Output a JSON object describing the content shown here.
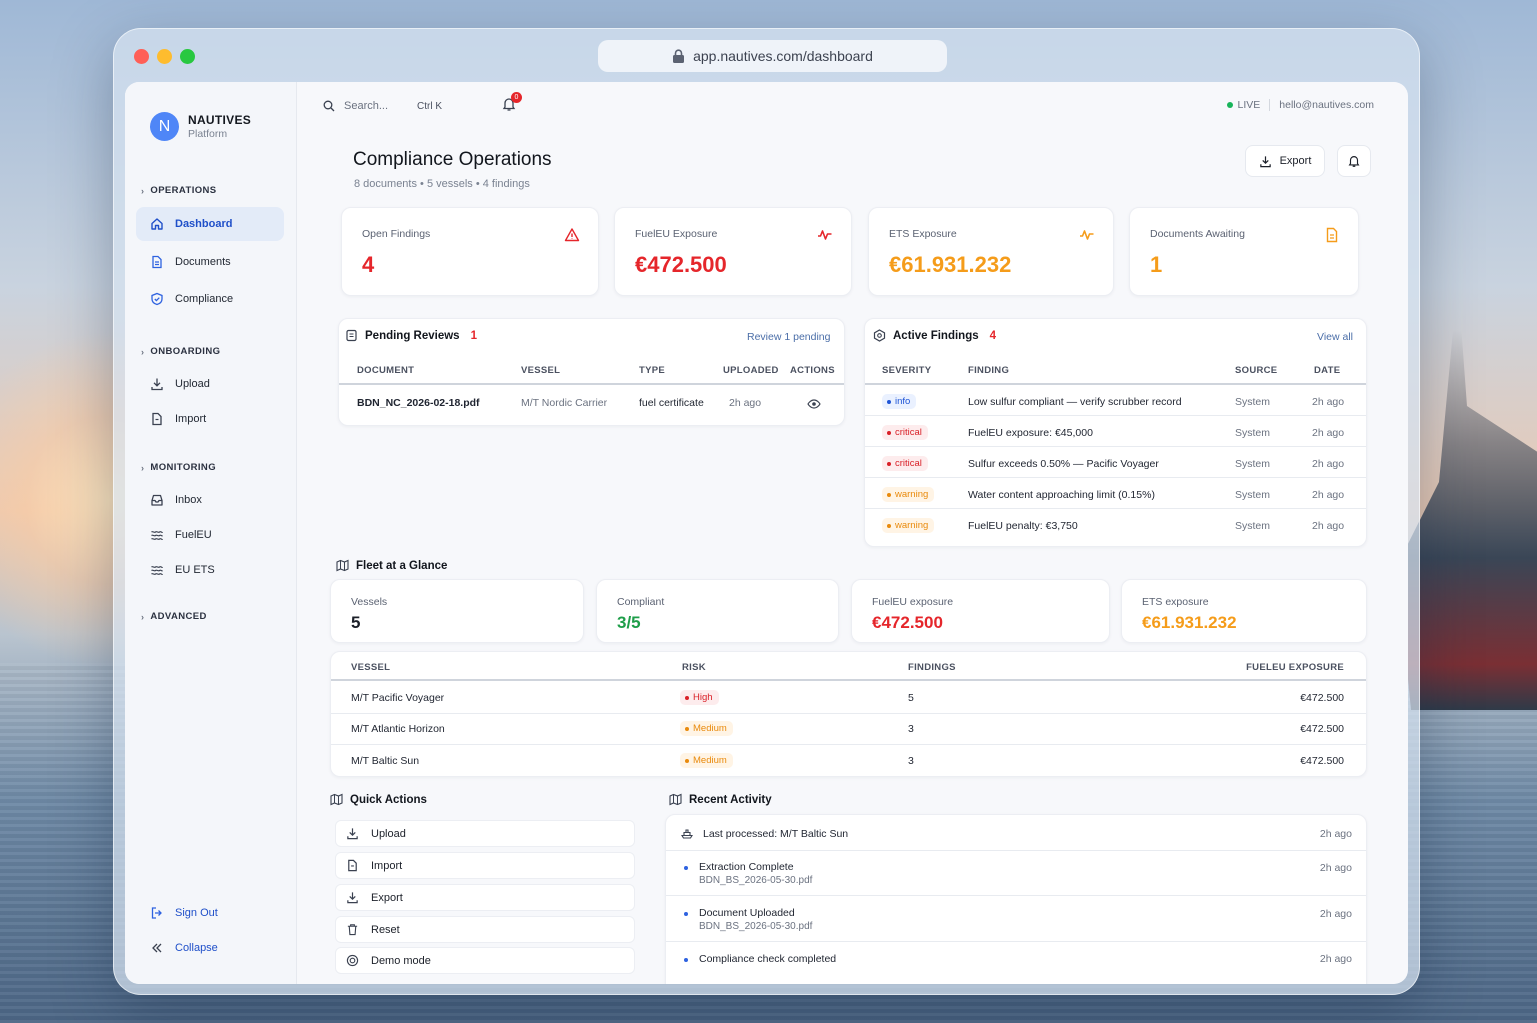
{
  "browser": {
    "url": "app.nautives.com/dashboard"
  },
  "brand": {
    "initial": "N",
    "name": "NAUTIVES",
    "subtitle": "Platform"
  },
  "sidebar": {
    "sections": [
      {
        "label": "OPERATIONS"
      },
      {
        "label": "ONBOARDING"
      },
      {
        "label": "MONITORING"
      },
      {
        "label": "ADVANCED"
      }
    ],
    "items": [
      {
        "label": "Dashboard",
        "icon": "home-icon",
        "active": true
      },
      {
        "label": "Documents",
        "icon": "document-icon"
      },
      {
        "label": "Compliance",
        "icon": "shield-icon"
      },
      {
        "label": "Upload",
        "icon": "download-icon"
      },
      {
        "label": "Import",
        "icon": "file-icon"
      },
      {
        "label": "Inbox",
        "icon": "inbox-icon"
      },
      {
        "label": "FuelEU",
        "icon": "waves-icon"
      },
      {
        "label": "EU ETS",
        "icon": "waves-icon"
      }
    ],
    "footer": {
      "sign_out": "Sign Out",
      "collapse": "Collapse"
    }
  },
  "topbar": {
    "search_placeholder": "Search...",
    "shortcut": "Ctrl K",
    "notification_count": "0",
    "status": "LIVE",
    "email": "hello@nautives.com"
  },
  "header": {
    "title": "Compliance Operations",
    "subtitle": "8 documents • 5 vessels • 4 findings",
    "export_label": "Export"
  },
  "stats": [
    {
      "label": "Open Findings",
      "value": "4",
      "color": "#e5262b",
      "icon": "alert-triangle-icon"
    },
    {
      "label": "FuelEU Exposure",
      "value": "€472.500",
      "color": "#e5262b",
      "icon": "pulse-icon"
    },
    {
      "label": "ETS Exposure",
      "value": "€61.931.232",
      "color": "#f59c1a",
      "icon": "pulse-icon"
    },
    {
      "label": "Documents Awaiting",
      "value": "1",
      "color": "#f59c1a",
      "icon": "document-icon"
    }
  ],
  "pending_reviews": {
    "title": "Pending Reviews",
    "count": "1",
    "link": "Review 1 pending",
    "columns": [
      "DOCUMENT",
      "VESSEL",
      "TYPE",
      "UPLOADED",
      "ACTIONS"
    ],
    "rows": [
      {
        "document": "BDN_NC_2026-02-18.pdf",
        "vessel": "M/T Nordic Carrier",
        "type": "fuel certificate",
        "uploaded": "2h ago"
      }
    ]
  },
  "active_findings": {
    "title": "Active Findings",
    "count": "4",
    "link": "View all",
    "columns": [
      "SEVERITY",
      "FINDING",
      "SOURCE",
      "DATE"
    ],
    "rows": [
      {
        "severity": "info",
        "finding": "Low sulfur compliant — verify scrubber record",
        "source": "System",
        "date": "2h ago"
      },
      {
        "severity": "critical",
        "finding": "FuelEU exposure: €45,000",
        "source": "System",
        "date": "2h ago"
      },
      {
        "severity": "critical",
        "finding": "Sulfur exceeds 0.50% — Pacific Voyager",
        "source": "System",
        "date": "2h ago"
      },
      {
        "severity": "warning",
        "finding": "Water content approaching limit (0.15%)",
        "source": "System",
        "date": "2h ago"
      },
      {
        "severity": "warning",
        "finding": "FuelEU penalty: €3,750",
        "source": "System",
        "date": "2h ago"
      }
    ]
  },
  "fleet": {
    "title": "Fleet at a Glance",
    "stats": [
      {
        "label": "Vessels",
        "value": "5",
        "color": "#1c2029"
      },
      {
        "label": "Compliant",
        "value": "3/5",
        "color": "#1f9e4a"
      },
      {
        "label": "FuelEU exposure",
        "value": "€472.500",
        "color": "#e5262b"
      },
      {
        "label": "ETS exposure",
        "value": "€61.931.232",
        "color": "#f59c1a"
      }
    ],
    "columns": [
      "VESSEL",
      "RISK",
      "FINDINGS",
      "FUELEU EXPOSURE"
    ],
    "rows": [
      {
        "vessel": "M/T Pacific Voyager",
        "risk": "High",
        "findings": "5",
        "exposure": "€472.500"
      },
      {
        "vessel": "M/T Atlantic Horizon",
        "risk": "Medium",
        "findings": "3",
        "exposure": "€472.500"
      },
      {
        "vessel": "M/T Baltic Sun",
        "risk": "Medium",
        "findings": "3",
        "exposure": "€472.500"
      }
    ]
  },
  "quick_actions": {
    "title": "Quick Actions",
    "items": [
      {
        "label": "Upload",
        "icon": "download-icon"
      },
      {
        "label": "Import",
        "icon": "file-icon"
      },
      {
        "label": "Export",
        "icon": "download-icon"
      },
      {
        "label": "Reset",
        "icon": "trash-icon"
      },
      {
        "label": "Demo mode",
        "icon": "target-icon"
      }
    ]
  },
  "recent_activity": {
    "title": "Recent Activity",
    "items": [
      {
        "title": "Last processed: M/T Baltic Sun",
        "detail": "",
        "time": "2h ago"
      },
      {
        "title": "Extraction Complete",
        "detail": "BDN_BS_2026-05-30.pdf",
        "time": "2h ago"
      },
      {
        "title": "Document Uploaded",
        "detail": "BDN_BS_2026-05-30.pdf",
        "time": "2h ago"
      },
      {
        "title": "Compliance check completed",
        "detail": "",
        "time": "2h ago"
      }
    ]
  }
}
